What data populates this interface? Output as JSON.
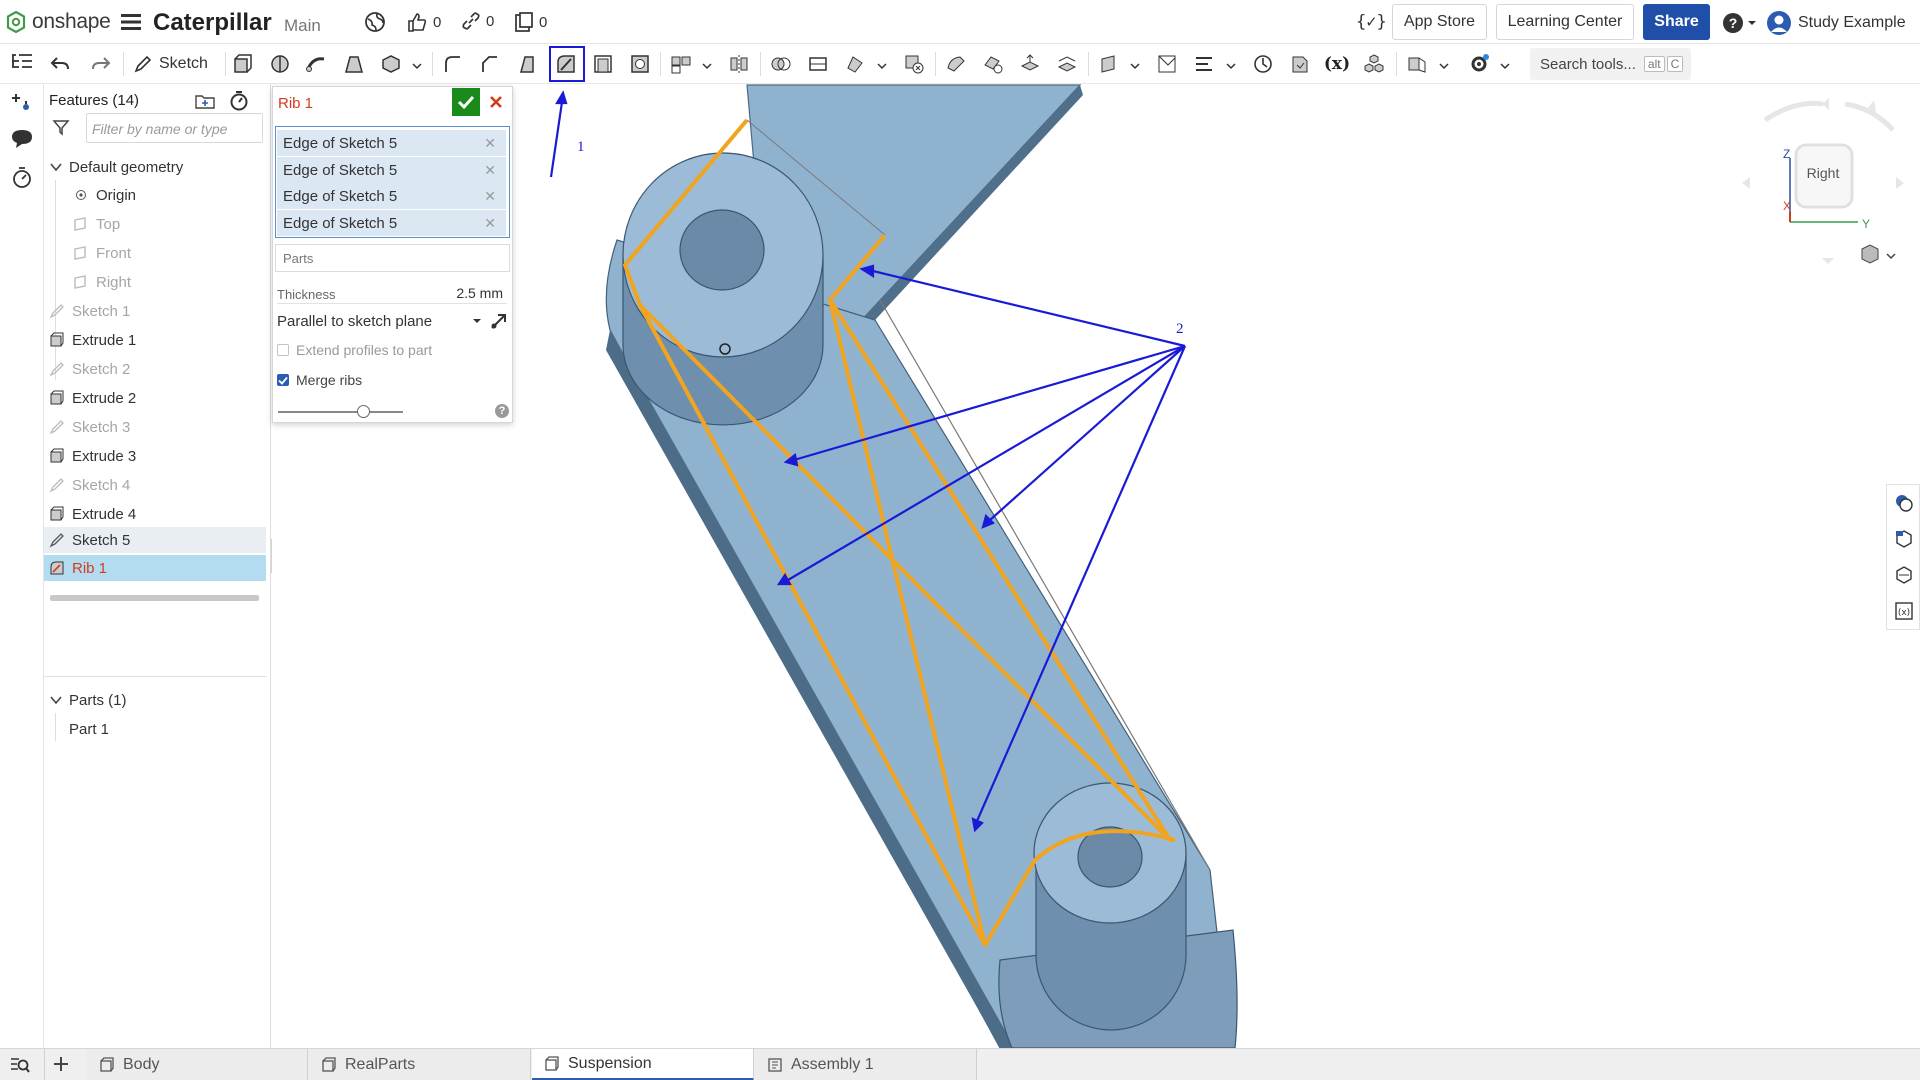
{
  "app": {
    "logo_text": "onshape",
    "doc_title": "Caterpillar",
    "doc_branch": "Main",
    "counters": {
      "likes": "0",
      "links": "0",
      "copies": "0"
    },
    "app_store": "App Store",
    "learning_center": "Learning Center",
    "share": "Share",
    "user": "Study Example"
  },
  "toolbar": {
    "sketch_label": "Sketch",
    "search_placeholder": "Search tools...",
    "search_shortcut_alt": "alt",
    "search_shortcut_key": "C"
  },
  "features": {
    "header": "Features (14)",
    "filter_placeholder": "Filter by name or type",
    "default_geometry": "Default geometry",
    "items": [
      {
        "label": "Origin"
      },
      {
        "label": "Top"
      },
      {
        "label": "Front"
      },
      {
        "label": "Right"
      },
      {
        "label": "Sketch 1"
      },
      {
        "label": "Extrude 1"
      },
      {
        "label": "Sketch 2"
      },
      {
        "label": "Extrude 2"
      },
      {
        "label": "Sketch 3"
      },
      {
        "label": "Extrude 3"
      },
      {
        "label": "Sketch 4"
      },
      {
        "label": "Extrude 4"
      },
      {
        "label": "Sketch 5"
      },
      {
        "label": "Rib 1"
      }
    ],
    "parts_header": "Parts (1)",
    "parts": [
      {
        "label": "Part 1"
      }
    ]
  },
  "rib_dialog": {
    "title": "Rib 1",
    "selections": [
      {
        "label": "Edge of Sketch 5"
      },
      {
        "label": "Edge of Sketch 5"
      },
      {
        "label": "Edge of Sketch 5"
      },
      {
        "label": "Edge of Sketch 5"
      }
    ],
    "parts_placeholder": "Parts",
    "thickness_label": "Thickness",
    "thickness_value": "2.5 mm",
    "direction": "Parallel to sketch plane",
    "extend_label": "Extend profiles to part",
    "extend_checked": false,
    "merge_label": "Merge ribs",
    "merge_checked": true,
    "help": "?"
  },
  "viewcube": {
    "face_label": "Right",
    "axis_z": "Z",
    "axis_y": "Y",
    "axis_x": "X"
  },
  "annotations": {
    "label_1": "1",
    "label_2": "2"
  },
  "tabs": [
    {
      "label": "Body",
      "active": false
    },
    {
      "label": "RealParts",
      "active": false
    },
    {
      "label": "Suspension",
      "active": true
    },
    {
      "label": "Assembly 1",
      "active": false
    }
  ],
  "colors": {
    "accent": "#1f4fa8",
    "rib_red": "#d23c1e",
    "sketch_orange": "#f0a41f",
    "annotation_blue": "#1a1ad6",
    "part_blue": "#8fb2cf",
    "confirm_green": "#1a8a1a",
    "selected_row": "#b3dcf0"
  }
}
